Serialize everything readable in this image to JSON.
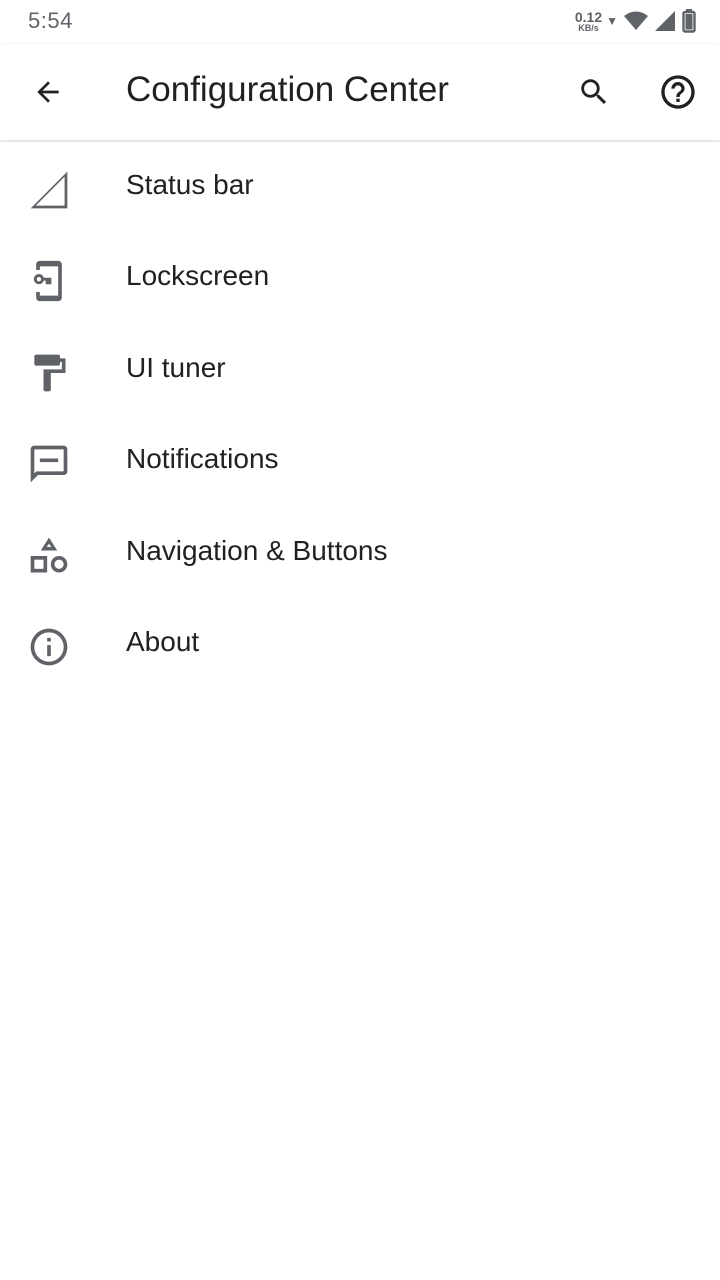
{
  "status_bar": {
    "time": "5:54",
    "net_speed_value": "0.12",
    "net_speed_unit": "KB/s"
  },
  "app_bar": {
    "title": "Configuration Center",
    "back_icon": "arrow-back-icon",
    "search_icon": "search-icon",
    "help_icon": "help-icon"
  },
  "menu": {
    "items": [
      {
        "label": "Status bar",
        "icon": "signal-triangle-icon"
      },
      {
        "label": "Lockscreen",
        "icon": "phone-lock-icon"
      },
      {
        "label": "UI tuner",
        "icon": "paint-roller-icon"
      },
      {
        "label": "Notifications",
        "icon": "message-icon"
      },
      {
        "label": "Navigation & Buttons",
        "icon": "shapes-icon"
      },
      {
        "label": "About",
        "icon": "info-icon"
      }
    ]
  },
  "colors": {
    "icon": "#5f6368",
    "text": "#202124",
    "background": "#ffffff"
  }
}
